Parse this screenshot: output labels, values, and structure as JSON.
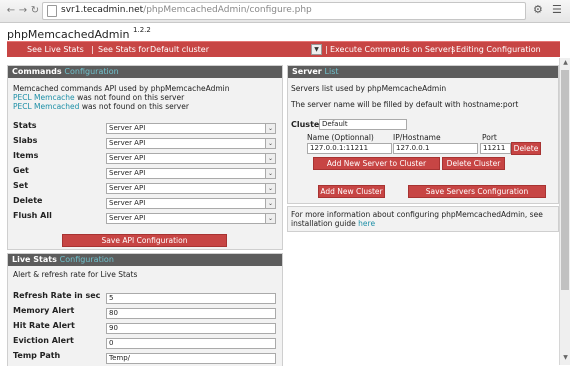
{
  "browser": {
    "url_host": "svr1.tecadmin.net",
    "url_path": "/phpMemcachedAdmin/configure.php"
  },
  "app": {
    "name": "phpMemcachedAdmin",
    "version": "1.2.2"
  },
  "topbar": {
    "live_stats": "See Live Stats",
    "sep1": "|",
    "stats_for": "See Stats for",
    "cluster": "Default cluster",
    "sep2": "|",
    "exec": "Execute Commands on Servers",
    "sep3": "|",
    "editing": "Editing Configuration"
  },
  "commands": {
    "title": "Commands",
    "subtitle": "Configuration",
    "intro": "Memcached commands API used by phpMemcacheAdmin",
    "n1_link": "PECL Memcache",
    "n1_text": "was not found on this server",
    "n2_link": "PECL Memcached",
    "n2_text": "was not found on this server",
    "rows": [
      {
        "label": "Stats",
        "value": "Server API"
      },
      {
        "label": "Slabs",
        "value": "Server API"
      },
      {
        "label": "Items",
        "value": "Server API"
      },
      {
        "label": "Get",
        "value": "Server API"
      },
      {
        "label": "Set",
        "value": "Server API"
      },
      {
        "label": "Delete",
        "value": "Server API"
      },
      {
        "label": "Flush All",
        "value": "Server API"
      }
    ],
    "save": "Save API Configuration"
  },
  "live": {
    "title": "Live Stats",
    "subtitle": "Configuration",
    "intro": "Alert & refresh rate for Live Stats",
    "rows": [
      {
        "label": "Refresh Rate in sec",
        "value": "5"
      },
      {
        "label": "Memory Alert",
        "value": "80"
      },
      {
        "label": "Hit Rate Alert",
        "value": "90"
      },
      {
        "label": "Eviction Alert",
        "value": "0"
      },
      {
        "label": "Temp Path",
        "value": "Temp/"
      }
    ]
  },
  "servers": {
    "title": "Server",
    "subtitle": "List",
    "intro": "Servers list used by phpMemcacheAdmin",
    "intro2": "The server name will be filled by default with hostname:port",
    "cluster_label": "Cluster",
    "cluster_value": "Default",
    "col_name": "Name (Optionnal)",
    "col_host": "IP/Hostname",
    "col_port": "Port",
    "name_value": "127.0.0.1:11211",
    "host_value": "127.0.0.1",
    "port_value": "11211",
    "delete": "Delete",
    "add_server": "Add New Server to Cluster",
    "delete_cluster": "Delete Cluster",
    "add_cluster": "Add New Cluster",
    "save_servers": "Save Servers Configuration"
  },
  "info": {
    "text": "For more information about configuring phpMemcachedAdmin, see",
    "text2": "installation guide",
    "link": "here"
  }
}
